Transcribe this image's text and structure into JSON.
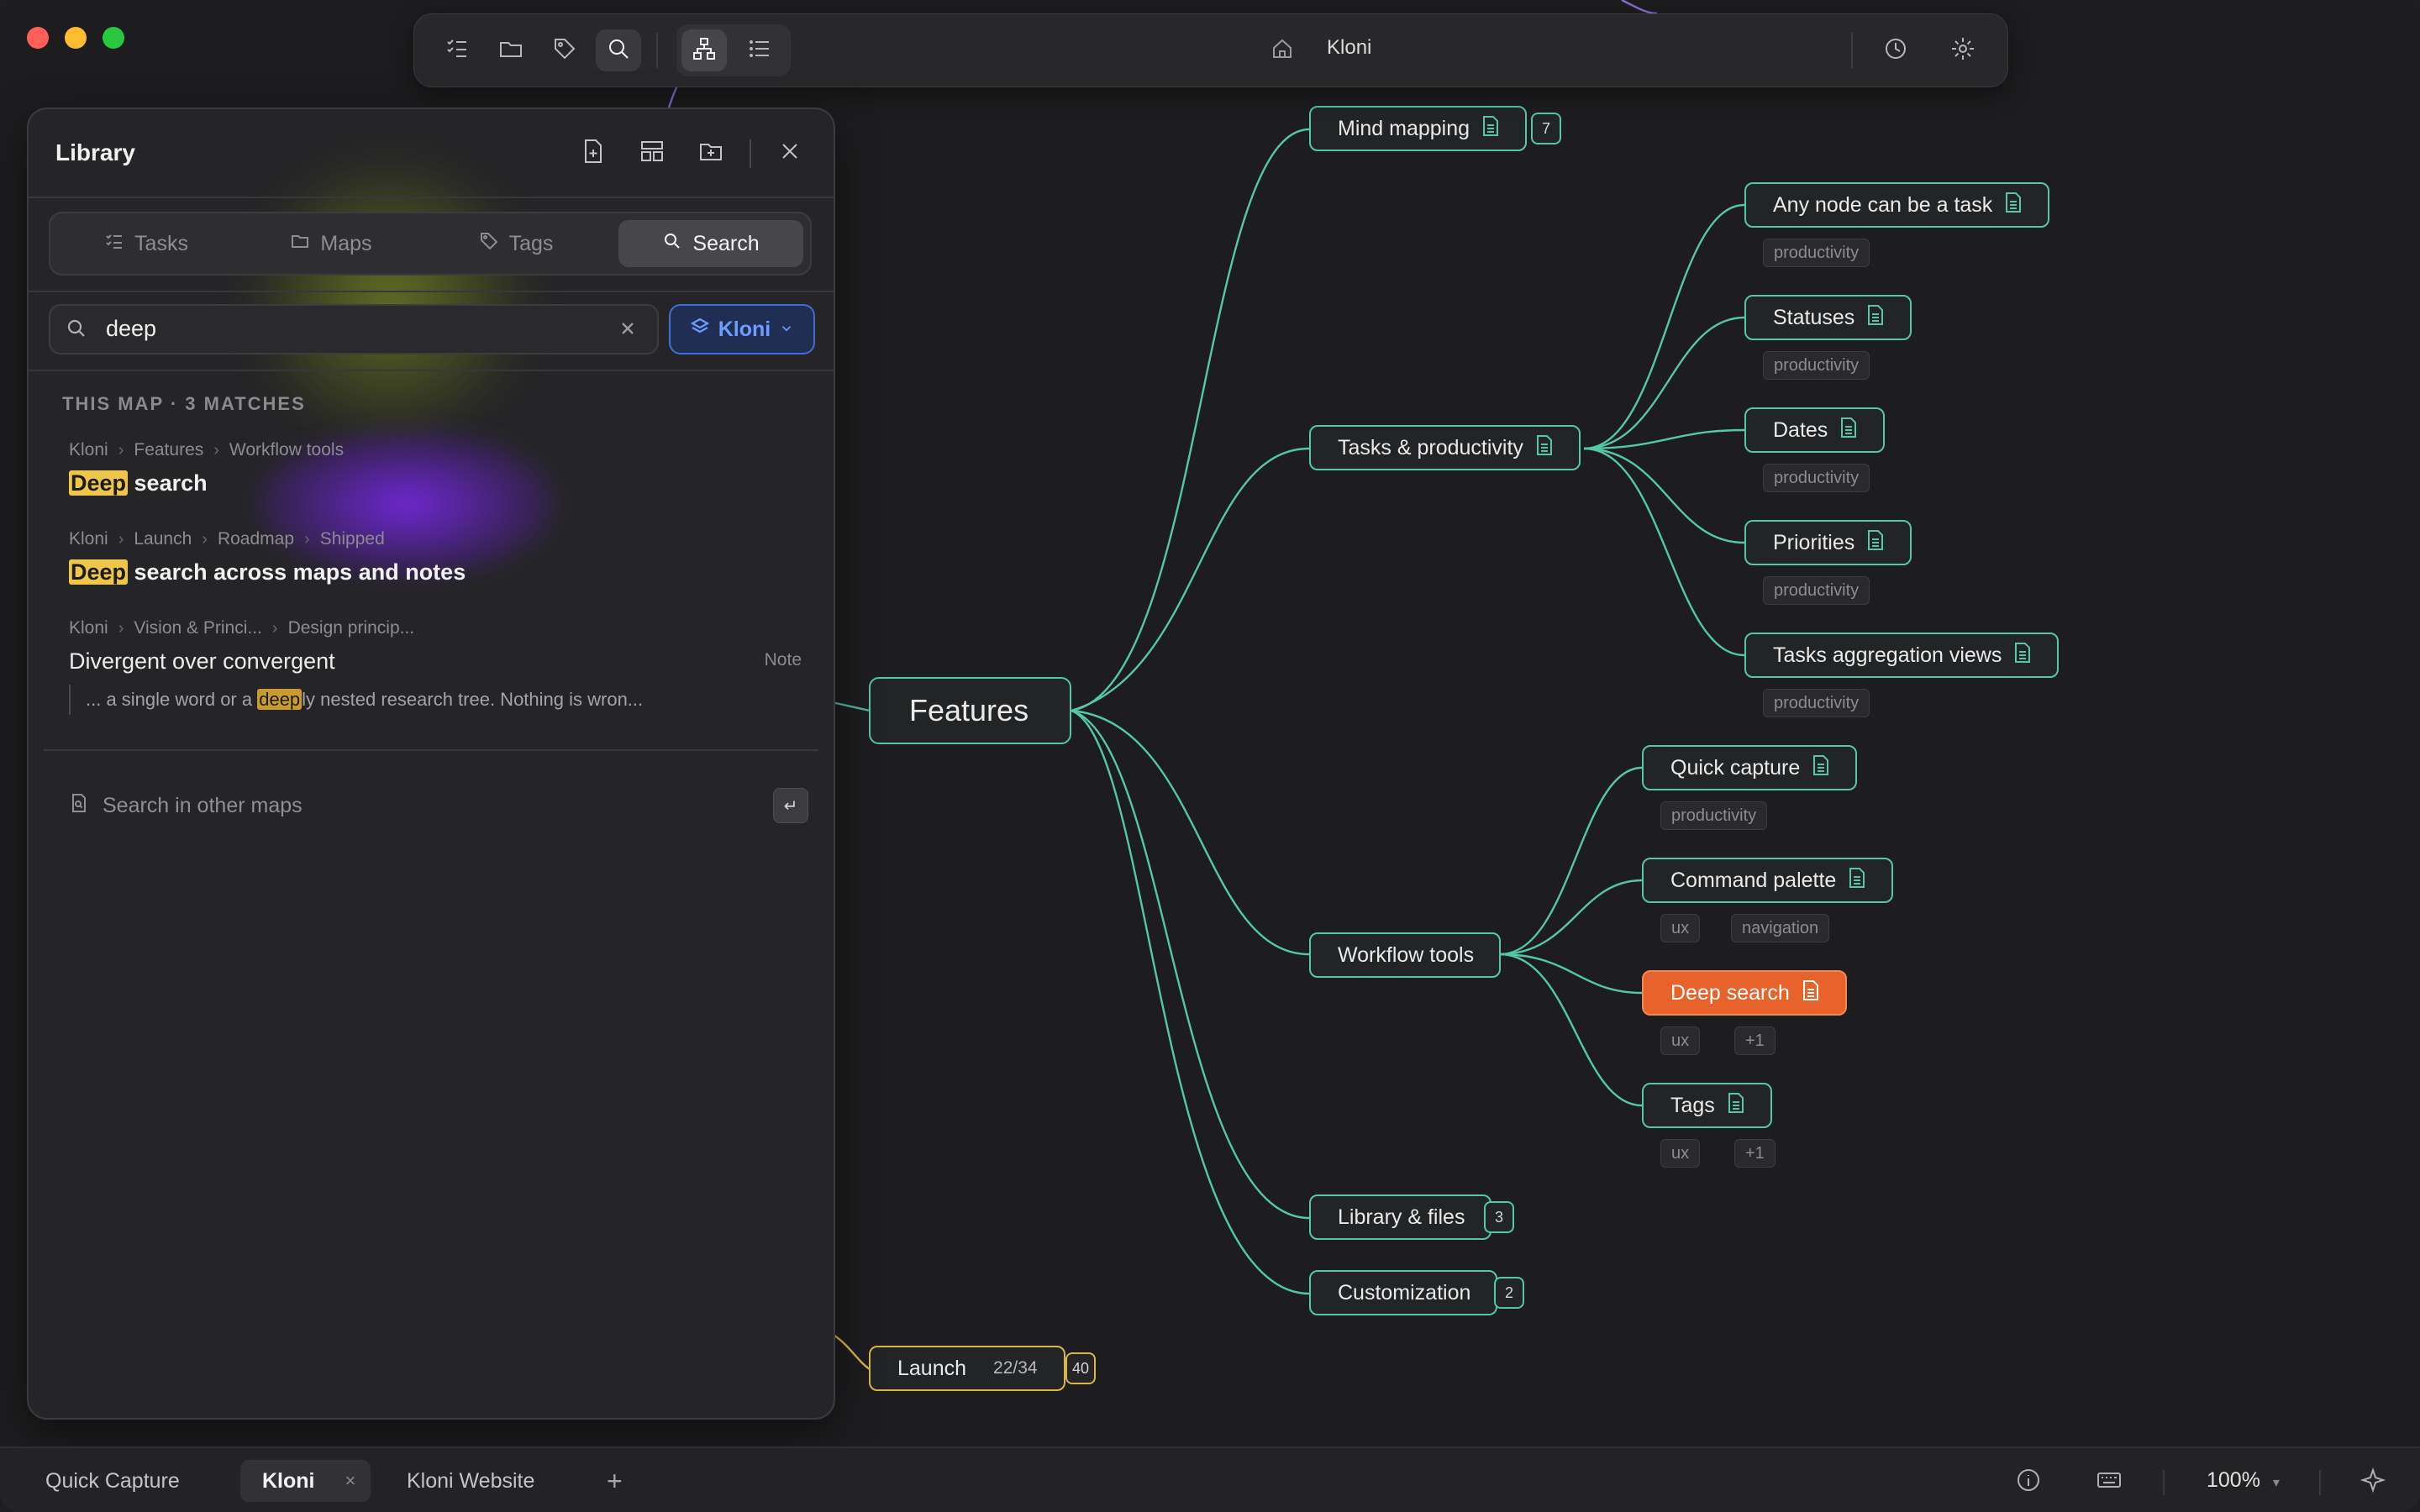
{
  "toolbar": {
    "title": "Kloni",
    "buttons": [
      "tasks-icon",
      "folder-icon",
      "tag-icon",
      "search-icon",
      "mindmap-icon",
      "outline-icon",
      "history-icon",
      "gear-icon"
    ]
  },
  "library": {
    "title": "Library",
    "tabs": [
      {
        "label": "Tasks",
        "icon": "tasks-icon"
      },
      {
        "label": "Maps",
        "icon": "folder-icon"
      },
      {
        "label": "Tags",
        "icon": "tag-icon"
      },
      {
        "label": "Search",
        "icon": "search-icon",
        "active": true
      }
    ],
    "search": {
      "value": "deep",
      "scope": "Kloni"
    },
    "section_header": "THIS MAP · 3 MATCHES",
    "results": [
      {
        "crumbs": [
          "Kloni",
          "Features",
          "Workflow tools"
        ],
        "highlight": "Deep",
        "rest": " search"
      },
      {
        "crumbs": [
          "Kloni",
          "Launch",
          "Roadmap",
          "Shipped"
        ],
        "highlight": "Deep",
        "rest": " search across maps and notes"
      },
      {
        "crumbs": [
          "Kloni",
          "Vision & Princi...",
          "Design princip..."
        ],
        "title": "Divergent over convergent",
        "kind": "Note",
        "snippet_pre": "... a single word or a ",
        "snippet_hl": "deep",
        "snippet_post": "ly nested research tree. Nothing is wron..."
      }
    ],
    "other_maps": "Search in other maps",
    "enter_key": "↵"
  },
  "map": {
    "root": "Features",
    "launch": {
      "label": "Launch",
      "progress": "22/34",
      "count": "40"
    },
    "branches": {
      "mind_mapping": {
        "label": "Mind mapping",
        "count": "7"
      },
      "tasks_productivity": {
        "label": "Tasks & productivity"
      },
      "workflow_tools": {
        "label": "Workflow tools"
      },
      "library_files": {
        "label": "Library & files",
        "count": "3"
      },
      "customization": {
        "label": "Customization",
        "count": "2"
      }
    },
    "tasks_children": [
      {
        "label": "Any node can be a task",
        "tag": "productivity"
      },
      {
        "label": "Statuses",
        "tag": "productivity"
      },
      {
        "label": "Dates",
        "tag": "productivity"
      },
      {
        "label": "Priorities",
        "tag": "productivity"
      },
      {
        "label": "Tasks aggregation views",
        "tag": "productivity"
      }
    ],
    "workflow_children": [
      {
        "label": "Quick capture",
        "tags": [
          "productivity"
        ]
      },
      {
        "label": "Command palette",
        "tags": [
          "ux",
          "navigation"
        ]
      },
      {
        "label": "Deep search",
        "tags": [
          "ux",
          "+1"
        ],
        "selected": true
      },
      {
        "label": "Tags",
        "tags": [
          "ux",
          "+1"
        ]
      }
    ],
    "colors": {
      "edge": "#54c7a7",
      "selected": "#e8622c",
      "launch": "#d9b44a"
    }
  },
  "bottom": {
    "tabs": [
      {
        "label": "Quick Capture"
      },
      {
        "label": "Kloni",
        "active": true,
        "close": "×"
      },
      {
        "label": "Kloni Website"
      }
    ],
    "add": "+",
    "zoom": "100%",
    "zoom_caret": "▾"
  }
}
